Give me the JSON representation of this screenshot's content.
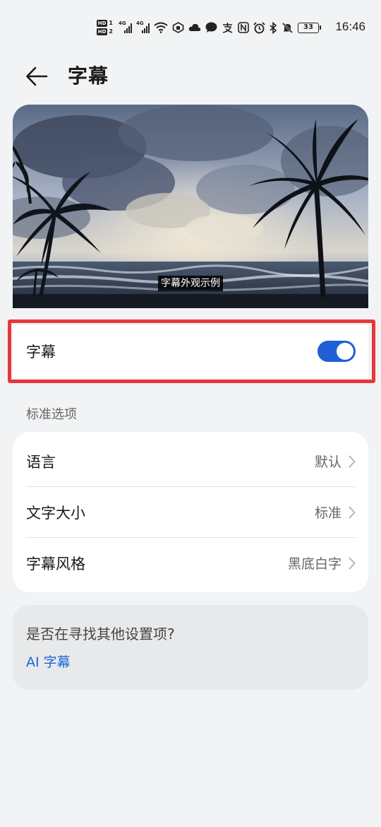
{
  "status_bar": {
    "hd1": "HD",
    "hd1_num": "1",
    "hd2": "HD",
    "hd2_num": "2",
    "sig1_tag": "4G",
    "sig2_tag": "4G",
    "battery": "33",
    "time": "16:46",
    "icons": [
      "hd-icon",
      "signal-icon",
      "signal-icon",
      "wifi-icon",
      "vpn-icon",
      "cloud-icon",
      "chat-icon",
      "alipay-icon",
      "nfc-icon",
      "alarm-icon",
      "bluetooth-icon",
      "mute-icon",
      "battery-icon"
    ]
  },
  "header": {
    "title": "字幕"
  },
  "preview": {
    "caption": "字幕外观示例"
  },
  "captions_toggle": {
    "label": "字幕",
    "on": true,
    "accent": "#1f5fd6",
    "highlight_color": "#e8373a"
  },
  "standard_options": {
    "section_label": "标准选项",
    "items": [
      {
        "label": "语言",
        "value": "默认"
      },
      {
        "label": "文字大小",
        "value": "标准"
      },
      {
        "label": "字幕风格",
        "value": "黑底白字"
      }
    ]
  },
  "suggestions": {
    "title": "是否在寻找其他设置项?",
    "link": "AI 字幕",
    "link_color": "#1a66d6"
  }
}
